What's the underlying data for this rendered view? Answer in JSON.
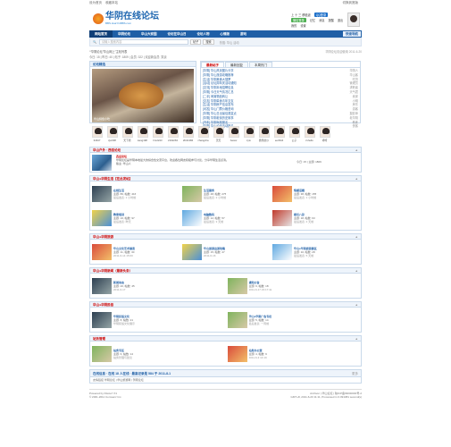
{
  "topbar": {
    "left1": "设为首页",
    "left2": "收藏本站",
    "right": "切换到宽版"
  },
  "logo": {
    "name": "华阴在线论坛",
    "sub": "BBS.HuaYinBBS.com"
  },
  "header": {
    "links": [
      "上 十 三 移植返",
      "QQ登录",
      "微信登录",
      "记忆",
      "消息",
      "提醒",
      "退出",
      "我的",
      "设置"
    ],
    "qq": "QQ登录",
    "wx": "微信登录"
  },
  "nav": {
    "items": [
      "网站首页",
      "华阴论坛",
      "华山大家园",
      "论坛在华山日",
      "论坛人物",
      "心情版",
      "游戏"
    ],
    "right": "快速导航"
  },
  "search": {
    "placeholder": "请输入搜索内容",
    "scope": "帖子",
    "button": "搜索",
    "hot": "热搜: 华山 活动"
  },
  "crumb": {
    "items": [
      "华阴论坛",
      "华山网上",
      "主帖列表"
    ],
    "right": "华阴论坛欢迎使用 2011-6-20"
  },
  "stats": {
    "text": "今日: 15 | 昨日: 40 | 帖子: 1809 | 会员: 322 | 欢迎新会员: 笑谈"
  },
  "slide": {
    "title": "论坛精选",
    "caption": "华山特色小吃"
  },
  "tabs": {
    "items": [
      "最新帖子",
      "最新回复",
      "本周热门"
    ]
  },
  "newthreads": [
    {
      "t": "[华阴] 华山风景图片分享",
      "a": "华阴人"
    },
    {
      "t": "[华阴] 华山旅游攻略推荐",
      "a": "华山客"
    },
    {
      "t": "[生活] 华阴美食大搜罗",
      "a": "吃货"
    },
    {
      "t": "[活动] 论坛周年庆活动通知",
      "a": "管理员"
    },
    {
      "t": "[交流] 华阴本地招聘信息",
      "a": "求职者"
    },
    {
      "t": "[华阴] 今日天气情况汇总",
      "a": "天气君"
    },
    {
      "t": "[二手] 闲置物品转让",
      "a": "卖家"
    },
    {
      "t": "[交友] 华阴单身青年交友",
      "a": "小明"
    },
    {
      "t": "[生活] 华阴房产信息发布",
      "a": "房东"
    },
    {
      "t": "[问答] 华山门票价格咨询",
      "a": "游客"
    },
    {
      "t": "[华阴] 华山日出最佳观赏点",
      "a": "摄影师"
    },
    {
      "t": "[华阴] 华阴老街历史故事",
      "a": "老华阴"
    },
    {
      "t": "[汽车] 华阴驾校报名",
      "a": "教练"
    },
    {
      "t": "[华阴] 华山论剑活动报名",
      "a": "侠客"
    }
  ],
  "members": [
    "34637",
    "zjw308",
    "天下熊",
    "kang198",
    "hrs2243",
    "2192263",
    "2D41386",
    "zhangxha",
    "天天",
    "hwww",
    "zylo",
    "微笑的沙",
    "ee3344",
    "公子",
    "zxhello",
    "呀呀"
  ],
  "sections": {
    "intro": {
      "title": "华山户外 · 西岳论坛",
      "name": "西岳论坛",
      "desc": "华阴论坛是华阴本地最大的综合性交流平台，欢迎各位网友积极参与讨论，分享华阴生活点滴。",
      "mod": "版主: 华山人",
      "side": "今日: 15 | 主题: 1809"
    },
    "life": {
      "title": "华山●华阴生活【在此发帖】",
      "items": [
        {
          "n": "在线生活",
          "s": "主题: 86, 帖数: 416",
          "b": "最后发表: 1 小时前"
        },
        {
          "n": "生活服务",
          "s": "主题: 48, 帖数: 275",
          "b": "最后发表: 2 小时前"
        },
        {
          "n": "情感话题",
          "s": "主题: 38, 帖数: 155",
          "b": "最后发表: 1 小时前"
        },
        {
          "n": "教育培训",
          "s": "主题: 16, 帖数: 97",
          "b": "最后发表: 昨天"
        },
        {
          "n": "电脑数码",
          "s": "主题: 12, 帖数: 57",
          "b": "最后发表: 3 天前"
        },
        {
          "n": "娱乐八卦",
          "s": "主题: 18, 帖数: 63",
          "b": "最后发表: 4 天前"
        }
      ]
    },
    "travel": {
      "title": "华山●华阴旅游",
      "items": [
        {
          "n": "华山文化艺术展览",
          "s": "主题: 11, 帖数: 30",
          "b": "2011-6-14 15:00"
        },
        {
          "n": "华山旅游出游攻略",
          "s": "主题: 15, 帖数: 47",
          "b": "2011-6-16"
        },
        {
          "n": "华山●华阴旅游景区",
          "s": "主题: 10, 帖数: 28",
          "b": "最后发表: 5 天前"
        }
      ]
    },
    "news": {
      "title": "华山●华阴新闻（最新头条）",
      "items": [
        {
          "n": "新闻动态",
          "s": "主题: 20, 帖数: 45",
          "b": "2011-6-17"
        },
        {
          "n": "通知公告",
          "s": "主题: 9, 帖数: 18",
          "b": "2011-6-17 23:17:42"
        }
      ]
    },
    "folk": {
      "title": "华山●华阴民俗",
      "items": [
        {
          "n": "华阴民俗文化",
          "s": "主题: 8, 帖数: 21",
          "b": "华阴民俗文化展示"
        },
        {
          "n": "华山●华阴广告专栏",
          "s": "主题: 5, 帖数: 14",
          "b": "最后发表: 一周前"
        }
      ]
    },
    "admin": {
      "title": "站务管理",
      "items": [
        {
          "n": "站务专区",
          "s": "主题: 6, 帖数: 14",
          "b": "站务管理与建议"
        },
        {
          "n": "站务办公室",
          "s": "主题: 4, 帖数: 9",
          "b": "2011-6-3 14:19"
        }
      ]
    }
  },
  "online": {
    "text": "在线信息 · 在线 18 人在线 · 最高记录是 584 于 2011-8-1",
    "more": "更多"
  },
  "links": {
    "title": "友情链接",
    "text": "华阴论坛 | 华山旅游网 | 渭南论坛"
  },
  "footer": {
    "left1": "Powered by Discuz! X1",
    "left2": "© 2001-2011 Comsenz Inc.",
    "right1": "Archiver | 华山论坛 | 陕ICP备09000000号-2",
    "right2": "GMT+8, 2011-6-20 11:11, Processed in 0.091081 second(s)"
  }
}
